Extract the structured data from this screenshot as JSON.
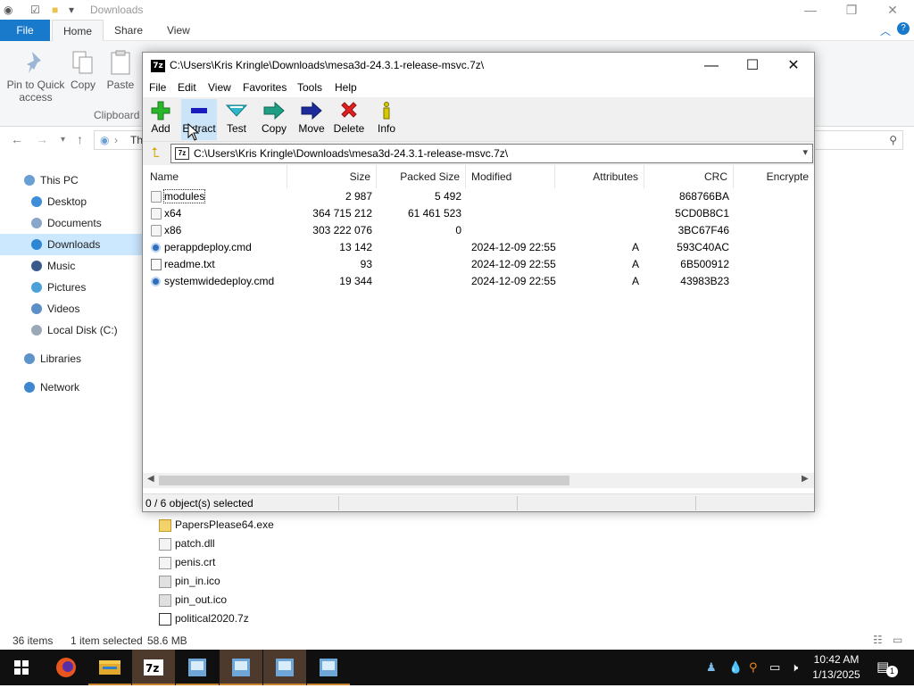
{
  "explorer": {
    "title": "Downloads",
    "tabs": [
      "File",
      "Home",
      "Share",
      "View"
    ],
    "ribbon_buttons": [
      {
        "label_line1": "Pin to Quick",
        "label_line2": "access",
        "icon": "pin-icon"
      },
      {
        "label": "Copy",
        "icon": "copy-icon"
      },
      {
        "label": "Paste",
        "icon": "paste-icon"
      }
    ],
    "ribbon_group": "Clipboard",
    "address_partial": "Th",
    "nav_items": [
      {
        "label": "This PC",
        "icon": "pc-icon"
      },
      {
        "label": "Desktop",
        "icon": "desktop-icon"
      },
      {
        "label": "Documents",
        "icon": "documents-icon"
      },
      {
        "label": "Downloads",
        "icon": "downloads-icon",
        "selected": true
      },
      {
        "label": "Music",
        "icon": "music-icon"
      },
      {
        "label": "Pictures",
        "icon": "pictures-icon"
      },
      {
        "label": "Videos",
        "icon": "videos-icon"
      },
      {
        "label": "Local Disk (C:)",
        "icon": "disk-icon"
      },
      {
        "label": "Libraries",
        "icon": "libraries-icon"
      },
      {
        "label": "Network",
        "icon": "network-icon"
      }
    ],
    "files": [
      "PapersPlease64.exe",
      "patch.dll",
      "penis.crt",
      "pin_in.ico",
      "pin_out.ico",
      "political2020.7z"
    ],
    "status": {
      "items": "36 items",
      "selected": "1 item selected",
      "size": "58.6 MB"
    }
  },
  "sevenzip": {
    "title": "C:\\Users\\Kris Kringle\\Downloads\\mesa3d-24.3.1-release-msvc.7z\\",
    "menu": [
      "File",
      "Edit",
      "View",
      "Favorites",
      "Tools",
      "Help"
    ],
    "toolbar": [
      {
        "label": "Add",
        "icon": "add-icon"
      },
      {
        "label": "Extract",
        "icon": "extract-icon"
      },
      {
        "label": "Test",
        "icon": "test-icon"
      },
      {
        "label": "Copy",
        "icon": "copy-icon"
      },
      {
        "label": "Move",
        "icon": "move-icon"
      },
      {
        "label": "Delete",
        "icon": "delete-icon"
      },
      {
        "label": "Info",
        "icon": "info-icon"
      }
    ],
    "address": "C:\\Users\\Kris Kringle\\Downloads\\mesa3d-24.3.1-release-msvc.7z\\",
    "columns": [
      "Name",
      "Size",
      "Packed Size",
      "Modified",
      "Attributes",
      "CRC",
      "Encrypte"
    ],
    "rows": [
      {
        "name": "modules",
        "type": "folder",
        "size": "2 987",
        "packed": "5 492",
        "modified": "",
        "attr": "",
        "crc": "868766BA"
      },
      {
        "name": "x64",
        "type": "folder",
        "size": "364 715 212",
        "packed": "61 461 523",
        "modified": "",
        "attr": "",
        "crc": "5CD0B8C1"
      },
      {
        "name": "x86",
        "type": "folder",
        "size": "303 222 076",
        "packed": "0",
        "modified": "",
        "attr": "",
        "crc": "3BC67F46"
      },
      {
        "name": "perappdeploy.cmd",
        "type": "cmd",
        "size": "13 142",
        "packed": "",
        "modified": "2024-12-09 22:55",
        "attr": "A",
        "crc": "593C40AC"
      },
      {
        "name": "readme.txt",
        "type": "txt",
        "size": "93",
        "packed": "",
        "modified": "2024-12-09 22:55",
        "attr": "A",
        "crc": "6B500912"
      },
      {
        "name": "systemwidedeploy.cmd",
        "type": "cmd",
        "size": "19 344",
        "packed": "",
        "modified": "2024-12-09 22:55",
        "attr": "A",
        "crc": "43983B23"
      }
    ],
    "status": "0 / 6 object(s) selected"
  },
  "taskbar": {
    "time": "10:42 AM",
    "date": "1/13/2025",
    "notification_count": "1"
  },
  "colors": {
    "accent": "#1979ca",
    "selection": "#cce8ff",
    "taskbar": "#101010"
  }
}
